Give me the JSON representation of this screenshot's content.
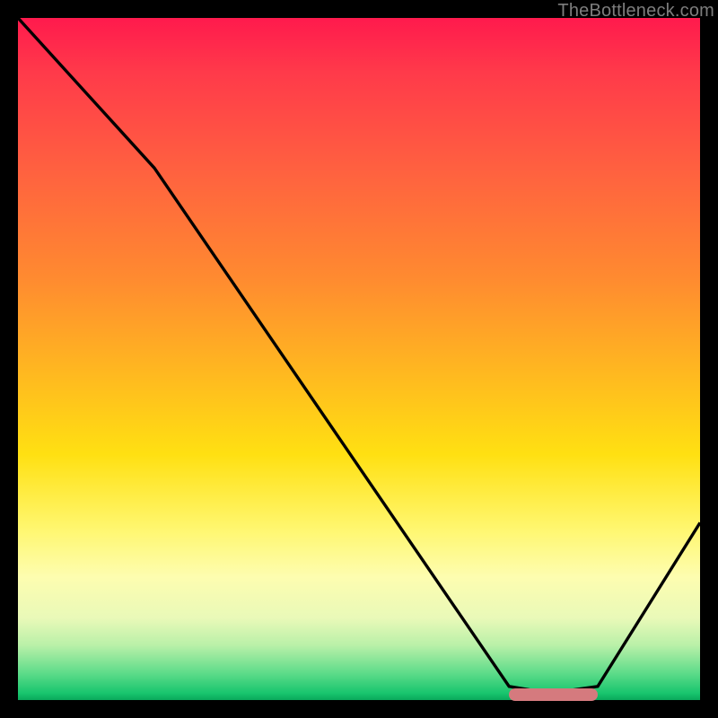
{
  "watermark": "TheBottleneck.com",
  "colors": {
    "frame_bg": "#000000",
    "curve": "#000000",
    "marker": "#d57a7e",
    "watermark": "#7d7d7d"
  },
  "chart_data": {
    "type": "line",
    "title": "",
    "xlabel": "",
    "ylabel": "",
    "xlim": [
      0,
      100
    ],
    "ylim": [
      0,
      100
    ],
    "grid": false,
    "legend": false,
    "series": [
      {
        "name": "bottleneck-curve",
        "x": [
          0,
          20,
          72,
          78,
          85,
          100
        ],
        "values": [
          100,
          78,
          2,
          1,
          2,
          26
        ]
      }
    ],
    "marker": {
      "x_start": 72,
      "x_end": 85,
      "y": 0.8
    },
    "gradient_stops": [
      {
        "pos": 0,
        "color": "#ff1a4d"
      },
      {
        "pos": 8,
        "color": "#ff3a4a"
      },
      {
        "pos": 22,
        "color": "#ff6040"
      },
      {
        "pos": 38,
        "color": "#ff8a30"
      },
      {
        "pos": 52,
        "color": "#ffb820"
      },
      {
        "pos": 64,
        "color": "#ffe012"
      },
      {
        "pos": 75,
        "color": "#fff770"
      },
      {
        "pos": 82,
        "color": "#fdfdb0"
      },
      {
        "pos": 88,
        "color": "#e9f9b8"
      },
      {
        "pos": 92,
        "color": "#b9f0a8"
      },
      {
        "pos": 96,
        "color": "#5fdc8a"
      },
      {
        "pos": 99,
        "color": "#18c56e"
      },
      {
        "pos": 100,
        "color": "#0aa85a"
      }
    ]
  }
}
